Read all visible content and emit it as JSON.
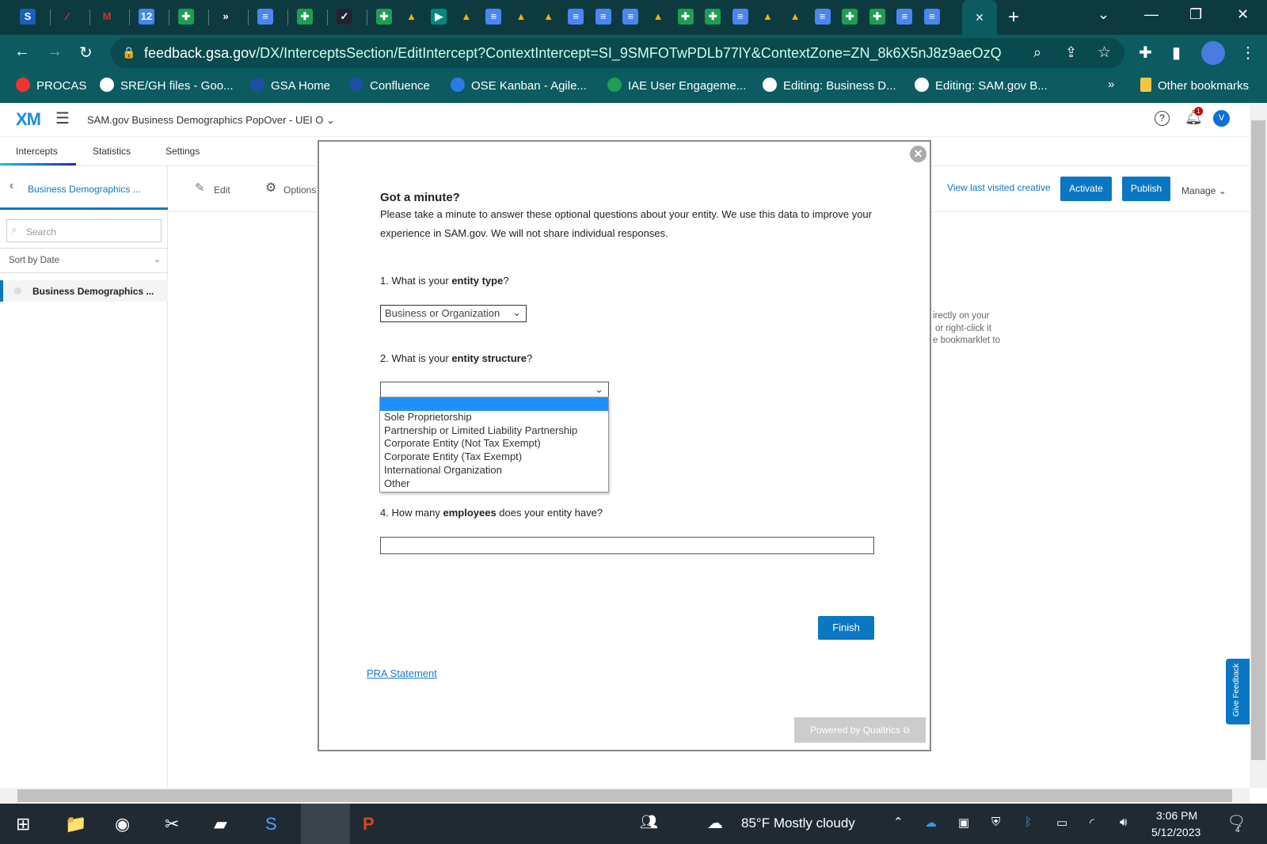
{
  "browser": {
    "tab_favicons": [
      "sam-icon",
      "procas-icon",
      "gmail-icon",
      "calendar-icon",
      "sheets-icon",
      "jira-icon",
      "docs-icon",
      "sheets-icon",
      "check-icon",
      "sheets-icon",
      "drive-icon",
      "meet-icon",
      "drive-icon",
      "docs-icon",
      "drive-icon",
      "drive-icon",
      "docs-icon",
      "docs-icon",
      "docs-icon",
      "drive-icon",
      "sheets-icon",
      "sheets-icon",
      "docs-icon",
      "drive-icon",
      "drive-icon",
      "docs-icon",
      "sheets-icon",
      "sheets-icon",
      "docs-icon",
      "docs-icon"
    ],
    "active_tab_close": "×",
    "new_tab": "+",
    "url_host": "feedback.gsa.gov",
    "url_path": "/DX/InterceptsSection/EditIntercept?ContextIntercept=SI_9SMFOTwPDLb77lY&ContextZone=ZN_8k6X5nJ8z9aeOzQ",
    "bookmarks": [
      "PROCAS",
      "SRE/GH files - Goo...",
      "GSA Home",
      "Confluence",
      "OSE Kanban - Agile...",
      "IAE User Engageme...",
      "Editing: Business D...",
      "Editing: SAM.gov B..."
    ],
    "bookmarks_more": "»",
    "other_bookmarks": "Other bookmarks"
  },
  "app": {
    "logo": "XM",
    "project_title": "SAM.gov Business Demographics PopOver - UEI O",
    "notification_count": "1",
    "avatar": "V",
    "tabs": [
      "Intercepts",
      "Statistics",
      "Settings"
    ],
    "back_label": "Business Demographics ...",
    "search_placeholder": "Search",
    "sort_label": "Sort by Date",
    "list_item": "Business Demographics ...",
    "edit": "Edit",
    "options": "Options",
    "view_last": "View last visited creative",
    "activate": "Activate",
    "publish": "Publish",
    "manage": "Manage",
    "bg_text": [
      "irectly on your",
      "or right-click it",
      "e bookmarklet to"
    ],
    "give_feedback": "Give Feedback"
  },
  "dialog": {
    "title": "Got a minute?",
    "intro": "Please take a minute to answer these optional questions about your entity. We use this data to improve your experience in SAM.gov. We will not share individual responses.",
    "q1": {
      "pre": "1. What is your ",
      "bold": "entity type",
      "post": "?",
      "value": "Business or Organization"
    },
    "q2": {
      "pre": "2. What is your ",
      "bold": "entity structure",
      "post": "?",
      "value": "",
      "options": [
        "Sole Proprietorship",
        "Partnership or Limited Liability Partnership",
        "Corporate Entity (Not Tax Exempt)",
        "Corporate Entity (Tax Exempt)",
        "International Organization",
        "Other"
      ]
    },
    "q4": {
      "pre": "4. How many ",
      "bold": "employees",
      "post": " does your entity have?",
      "value": ""
    },
    "finish": "Finish",
    "pra": "PRA Statement",
    "powered": "Powered by Qualtrics"
  },
  "taskbar": {
    "weather": "85°F  Mostly cloudy",
    "time": "3:06 PM",
    "date": "5/12/2023",
    "notifications": "4"
  }
}
